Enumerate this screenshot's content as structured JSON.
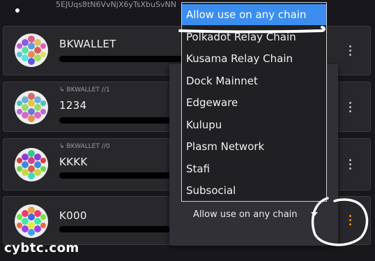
{
  "top_row": {
    "address": "5EJUqs8tN6VvNjX6yTsXbuSvNN"
  },
  "accounts": [
    {
      "name": "BKWALLET",
      "parent": ""
    },
    {
      "name": "1234",
      "parent": "↳ BKWALLET //1"
    },
    {
      "name": "KKKK",
      "parent": "↳ BKWALLET //0"
    },
    {
      "name": "K000",
      "parent": ""
    }
  ],
  "chain_select": {
    "current_value": "Allow use on any chain",
    "options": [
      "Allow use on any chain",
      "Polkadot Relay Chain",
      "Kusama Relay Chain",
      "Dock Mainnet",
      "Edgeware",
      "Kulupu",
      "Plasm Network",
      "Stafi",
      "Subsocial"
    ]
  },
  "watermark": "cybtc.com",
  "colors": {
    "selected_option": "#3b8ef0",
    "active_menu_dots": "#ff8c00",
    "card_background": "#27272c"
  },
  "icons": {
    "account_avatar": "polkadot-identicon",
    "menu": "vertical-ellipsis",
    "select_arrow": "triangle-down"
  }
}
